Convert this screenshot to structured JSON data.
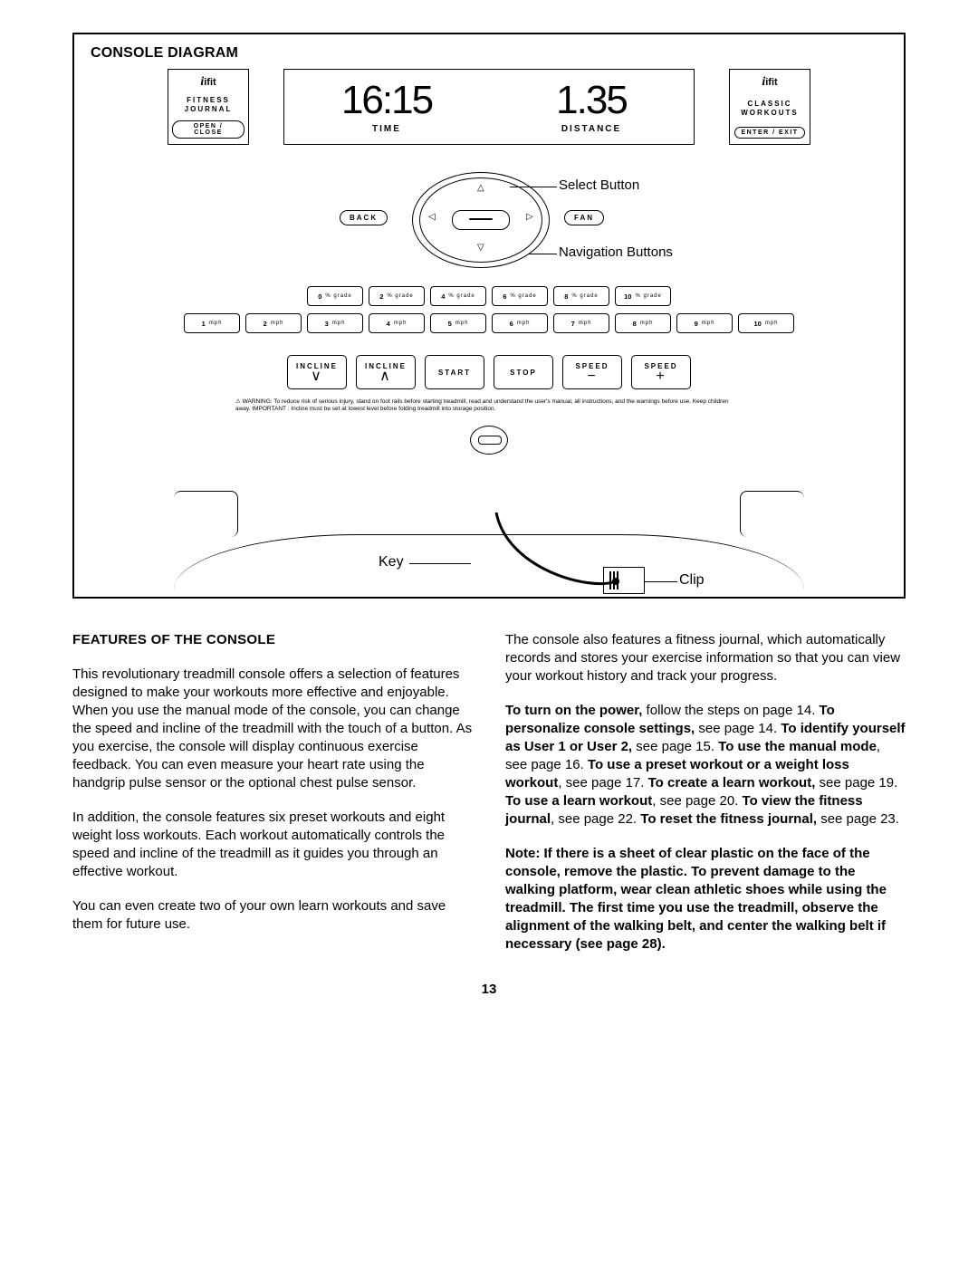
{
  "diagram": {
    "title": "CONSOLE DIAGRAM",
    "left_box": {
      "brand": "ifit",
      "line1": "FITNESS",
      "line2": "JOURNAL",
      "button": "OPEN / CLOSE"
    },
    "right_box": {
      "brand": "ifit",
      "line1": "CLASSIC",
      "line2": "WORKOUTS",
      "button": "ENTER / EXIT"
    },
    "lcd": {
      "time_val": "16:15",
      "time_lab": "TIME",
      "dist_val": "1.35",
      "dist_lab": "DISTANCE"
    },
    "nav": {
      "back": "BACK",
      "fan": "FAN",
      "select_annot": "Select Button",
      "nav_annot": "Navigation Buttons"
    },
    "grade_row": [
      {
        "n": "0",
        "u": "% grade"
      },
      {
        "n": "2",
        "u": "% grade"
      },
      {
        "n": "4",
        "u": "% grade"
      },
      {
        "n": "6",
        "u": "% grade"
      },
      {
        "n": "8",
        "u": "% grade"
      },
      {
        "n": "10",
        "u": "% grade"
      }
    ],
    "speed_row": [
      {
        "n": "1",
        "u": "mph"
      },
      {
        "n": "2",
        "u": "mph"
      },
      {
        "n": "3",
        "u": "mph"
      },
      {
        "n": "4",
        "u": "mph"
      },
      {
        "n": "5",
        "u": "mph"
      },
      {
        "n": "6",
        "u": "mph"
      },
      {
        "n": "7",
        "u": "mph"
      },
      {
        "n": "8",
        "u": "mph"
      },
      {
        "n": "9",
        "u": "mph"
      },
      {
        "n": "10",
        "u": "mph"
      }
    ],
    "lower_row": [
      {
        "t": "INCLINE",
        "s": "∨"
      },
      {
        "t": "INCLINE",
        "s": "∧"
      },
      {
        "t": "START",
        "s": ""
      },
      {
        "t": "STOP",
        "s": ""
      },
      {
        "t": "SPEED",
        "s": "−"
      },
      {
        "t": "SPEED",
        "s": "+"
      }
    ],
    "warning": "⚠ WARNING: To reduce risk of serious injury, stand on foot rails before starting treadmill, read and understand the user's manual, all instructions, and the warnings before use. Keep children away.   IMPORTANT : Incline must be set at lowest level before folding treadmill into storage position.",
    "key_label": "Key",
    "clip_label": "Clip"
  },
  "features_heading": "FEATURES OF THE CONSOLE",
  "p1": "This revolutionary treadmill console offers a selection of features designed to make your workouts more effective and enjoyable. When you use the manual mode of the console, you can change the speed and incline of the treadmill with the touch of a button. As you exercise, the console will display continuous exercise feedback. You can even measure your heart rate using the handgrip pulse sensor or the optional chest pulse sensor.",
  "p2": "In addition, the console features six preset workouts and eight weight loss workouts. Each workout automatically controls the speed and incline of the treadmill as it guides you through an effective workout.",
  "p3": "You can even create two of your own learn workouts and save them for future use.",
  "p4": "The console also features a fitness journal, which automatically records and stores your exercise information so that you can view your workout history and track your progress.",
  "p5_html": "<b>To turn on the power,</b> follow the steps on page 14. <b>To personalize console settings,</b> see page 14. <b>To identify yourself as User 1 or User 2,</b> see page 15. <b>To use the manual mode</b>, see page 16. <b>To use a preset workout or a weight loss workout</b>, see page 17. <b>To create a learn workout,</b> see page 19. <b>To use a learn workout</b>, see page 20. <b>To view the fitness journal</b>, see page 22. <b>To reset the fitness journal,</b> see page 23.",
  "p6_html": "<b>Note: If there is a sheet of clear plastic on the face of the console, remove the plastic. To prevent damage to the walking platform, wear clean athletic shoes while using the treadmill. The first time you use the treadmill, observe the alignment of the walking belt, and center the walking belt if necessary (see page 28).</b>",
  "page_number": "13"
}
